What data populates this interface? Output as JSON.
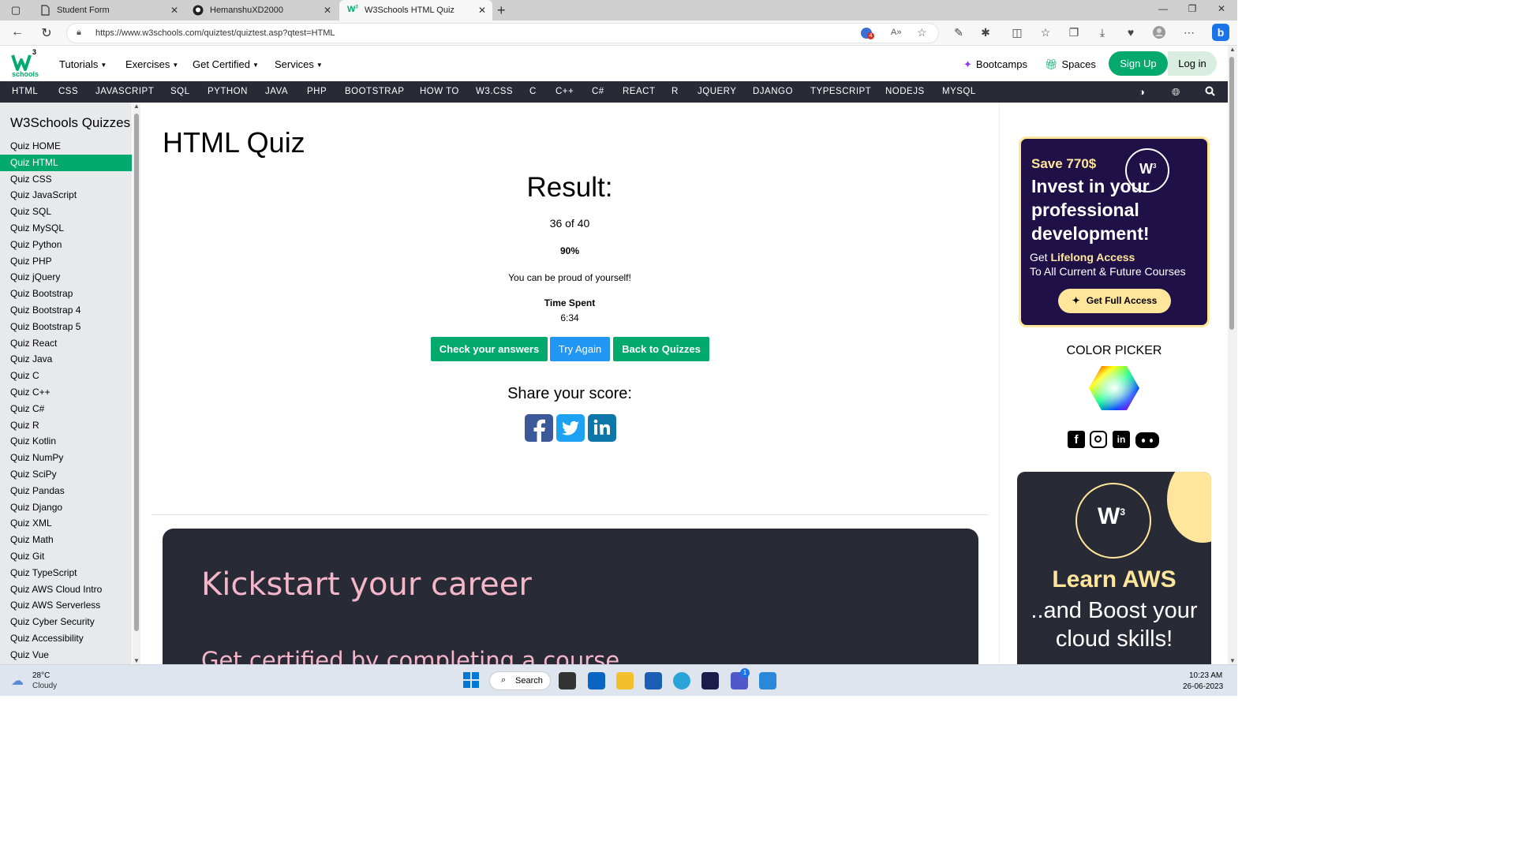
{
  "browser": {
    "tabs": [
      {
        "title": "Student Form",
        "active": false
      },
      {
        "title": "HemanshuXD2000",
        "active": false
      },
      {
        "title": "W3Schools HTML Quiz",
        "active": true
      }
    ],
    "url": "https://www.w3schools.com/quiztest/quiztest.asp?qtest=HTML",
    "notification_badge": "4"
  },
  "header": {
    "logo_text": "schools",
    "logo_superscript": "3",
    "menus": [
      "Tutorials",
      "Exercises",
      "Get Certified",
      "Services"
    ],
    "bootcamps": "Bootcamps",
    "spaces": "Spaces",
    "signup": "Sign Up",
    "login": "Log in"
  },
  "topnav": [
    "HTML",
    "CSS",
    "JAVASCRIPT",
    "SQL",
    "PYTHON",
    "JAVA",
    "PHP",
    "BOOTSTRAP",
    "HOW TO",
    "W3.CSS",
    "C",
    "C++",
    "C#",
    "REACT",
    "R",
    "JQUERY",
    "DJANGO",
    "TYPESCRIPT",
    "NODEJS",
    "MYSQL"
  ],
  "sidebar": {
    "title": "W3Schools Quizzes",
    "active_index": 1,
    "items": [
      "Quiz HOME",
      "Quiz HTML",
      "Quiz CSS",
      "Quiz JavaScript",
      "Quiz SQL",
      "Quiz MySQL",
      "Quiz Python",
      "Quiz PHP",
      "Quiz jQuery",
      "Quiz Bootstrap",
      "Quiz Bootstrap 4",
      "Quiz Bootstrap 5",
      "Quiz React",
      "Quiz Java",
      "Quiz C",
      "Quiz C++",
      "Quiz C#",
      "Quiz R",
      "Quiz Kotlin",
      "Quiz NumPy",
      "Quiz SciPy",
      "Quiz Pandas",
      "Quiz Django",
      "Quiz XML",
      "Quiz Math",
      "Quiz Git",
      "Quiz TypeScript",
      "Quiz AWS Cloud Intro",
      "Quiz AWS Serverless",
      "Quiz Cyber Security",
      "Quiz Accessibility",
      "Quiz Vue"
    ]
  },
  "main": {
    "title": "HTML Quiz",
    "result_label": "Result:",
    "score": "36 of 40",
    "percent": "90%",
    "message": "You can be proud of yourself!",
    "time_label": "Time Spent",
    "time_value": "6:34",
    "buttons": {
      "check": "Check your answers",
      "try_again": "Try Again",
      "back": "Back to Quizzes"
    },
    "share_label": "Share your score:",
    "career_title": "Kickstart your career",
    "career_sub": "Get certified by completing a course"
  },
  "right": {
    "ad1": {
      "save": "Save 770$",
      "headline": "Invest in your professional development!",
      "get_prefix": "Get",
      "get_bold": "Lifelong Access",
      "to": "To All Current & Future Courses",
      "button": "Get Full Access"
    },
    "color_picker": "COLOR PICKER",
    "ad2": {
      "learn": "Learn AWS",
      "boost": "..and Boost your cloud skills!"
    }
  },
  "taskbar": {
    "temp": "28°C",
    "weather": "Cloudy",
    "search": "Search",
    "time": "10:23 AM",
    "date": "26-06-2023",
    "teams_badge": "1"
  },
  "colors": {
    "w3_green": "#04aa6d",
    "topnav_bg": "#282a35",
    "try_again_blue": "#2196f3",
    "career_pink": "#f4b6c8",
    "ad_yellow": "#ffe69a"
  }
}
